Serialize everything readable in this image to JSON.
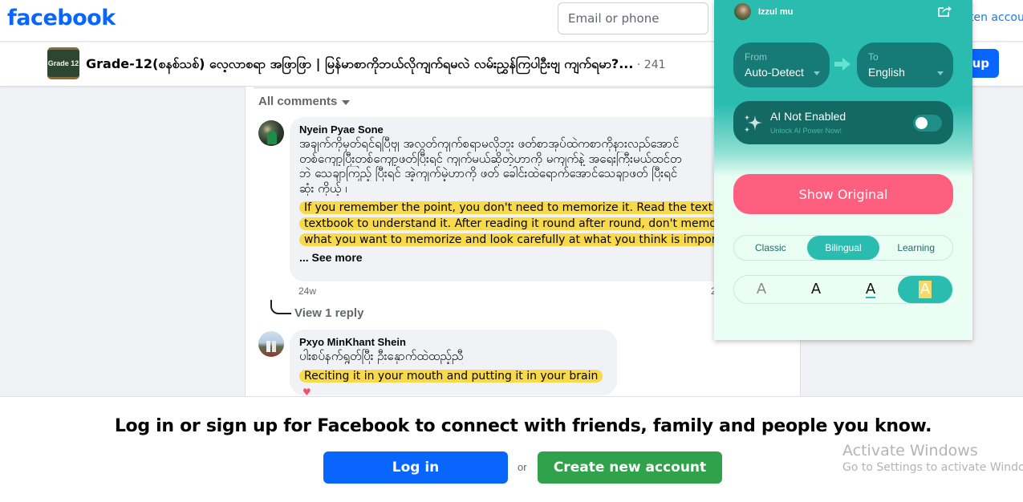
{
  "header": {
    "logo": "facebook",
    "email_placeholder": "Email or phone",
    "forgot_link": "ten accou"
  },
  "group": {
    "thumb_label": "Grade 12",
    "title": "Grade-12(စနစ်သစ်) လေ့လာစရာ အဖြာဖြာ | မြန်မာစာကိုဘယ်လိုကျက်ရမလဲ လမ်းညွှန်ကြပါဦးဗျ ကျက်ရမာ?...",
    "count": " · 241",
    "join_label": "oup"
  },
  "comments": {
    "sort_label": "All comments",
    "items": [
      {
        "author": "Nyein Pyae Sone",
        "native_lines": [
          "အချက်ကိုမှတ်ရင်ရပြီဗျ အလွတ်ကျက်စရာမလိုဘူး ဖတ်စာအုပ်ထဲကစာကိုနားလည်အောင်",
          "တစ်ကျော့ပြီးတစ်ကျော့ဖတ်ပြီးရင် ကျက်မယ်ဆိုတဲ့ဟာကို မကျက်နဲ့ အရေးကြီးမယ်ထင်တ",
          "ဘဲ သေချာကြည့် ပြီးရင် အဲ့ကျက်မဲ့ဟာကို ဖတ် ခေါင်းထဲရောက်အောင်သေချာဖတ် ပြီးရင်",
          "ဆုံး ကိုယ့် ၊"
        ],
        "translation": "If you remember the point, you don't need to memorize it. Read the text in the textbook to understand it. After reading it round after round, don't memorize what you want to memorize and look carefully at what you think is important.",
        "see_more": "... See more",
        "time": "24w",
        "time_right": "2",
        "view_replies": "View 1 reply"
      },
      {
        "author": "Pxyo MinKhant Shein",
        "native_lines": [
          "ပါးစပ်နက်ရွတ်ပြီး ဦးနှောက်ထဲထည့်ညီ"
        ],
        "translation": "Reciting it in your mouth and putting it in your brain",
        "reaction": "♥"
      }
    ]
  },
  "login_banner": {
    "text": "Log in or sign up for Facebook to connect with friends, family and people you know.",
    "login_label": "Log in",
    "or_label": "or",
    "create_label": "Create new account"
  },
  "windows_watermark": {
    "title": "Activate Windows",
    "subtitle": "Go to Settings to activate Windows."
  },
  "extension": {
    "username": "Izzul mu",
    "from_label": "From",
    "from_value": "Auto-Detect",
    "to_label": "To",
    "to_value": "English",
    "ai_title": "AI Not Enabled",
    "ai_subtitle": "Unlock AI Power Now!",
    "ai_enabled": false,
    "show_original_label": "Show Original",
    "modes": [
      {
        "label": "Classic",
        "active": false
      },
      {
        "label": "Bilingual",
        "active": true
      },
      {
        "label": "Learning",
        "active": false
      }
    ],
    "styles": [
      {
        "glyph": "A",
        "name": "faded"
      },
      {
        "glyph": "A",
        "name": "plain"
      },
      {
        "glyph": "A",
        "name": "underlined"
      },
      {
        "glyph": "A",
        "name": "highlighted",
        "active": true
      }
    ],
    "colors": {
      "accent": "#2bbcb0",
      "dark": "#136963",
      "show_original": "#ff5f7e",
      "highlight": "#f8d94a"
    }
  }
}
